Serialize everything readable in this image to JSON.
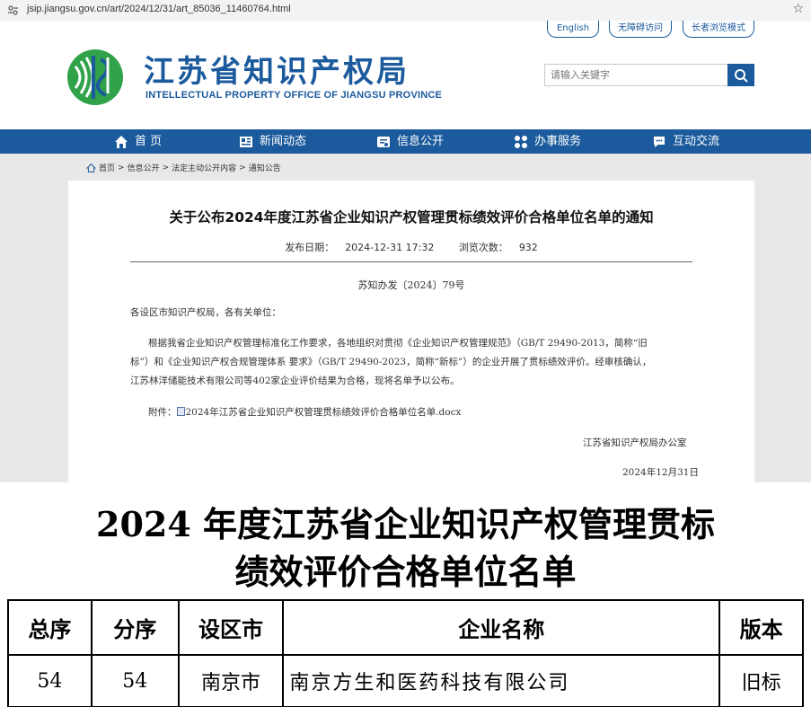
{
  "browser": {
    "url": "jsip.jiangsu.gov.cn/art/2024/12/31/art_85036_11460764.html"
  },
  "top_links": [
    "English",
    "无障碍访问",
    "长者浏览模式"
  ],
  "header": {
    "title_cn": "江苏省知识产权局",
    "title_en": "INTELLECTUAL PROPERTY OFFICE OF JIANGSU PROVINCE",
    "search_placeholder": "请输入关键字"
  },
  "nav": [
    {
      "label": "首 页",
      "icon": "home-icon"
    },
    {
      "label": "新闻动态",
      "icon": "news-icon"
    },
    {
      "label": "信息公开",
      "icon": "info-icon"
    },
    {
      "label": "办事服务",
      "icon": "service-icon"
    },
    {
      "label": "互动交流",
      "icon": "chat-icon"
    }
  ],
  "breadcrumb": [
    "首页",
    "信息公开",
    "法定主动公开内容",
    "通知公告"
  ],
  "article": {
    "title": "关于公布2024年度江苏省企业知识产权管理贯标绩效评价合格单位名单的通知",
    "publish_label": "发布日期：",
    "publish_date": "2024-12-31 17:32",
    "views_label": "浏览次数：",
    "views": "932",
    "doc_no": "苏知办发〔2024〕79号",
    "salutation": "各设区市知识产权局，各有关单位：",
    "body_line1": "根据我省企业知识产权管理标准化工作要求，各地组织对贯彻《企业知识产权管理规范》（GB/T 29490-2013，简称“旧",
    "body_line2": "标”）和《企业知识产权合规管理体系 要求》（GB/T 29490-2023，简称“新标”）的企业开展了贯标绩效评价。经审核确认，",
    "body_line3": "江苏林洋储能技术有限公司等402家企业评价结果为合格，现将名单予以公布。",
    "attachment_label": "附件：",
    "attachment_file": "2024年江苏省企业知识产权管理贯标绩效评价合格单位名单.docx",
    "signature": "江苏省知识产权局办公室",
    "date": "2024年12月31日"
  },
  "document": {
    "heading_line1": "2024 年度江苏省企业知识产权管理贯标",
    "heading_line2": "绩效评价合格单位名单",
    "columns": [
      "总序",
      "分序",
      "设区市",
      "企业名称",
      "版本"
    ],
    "rows": [
      [
        "54",
        "54",
        "南京市",
        "南京方生和医药科技有限公司",
        "旧标"
      ]
    ]
  },
  "colors": {
    "brand_blue": "#1b5a9c",
    "logo_green": "#2fa24a"
  }
}
